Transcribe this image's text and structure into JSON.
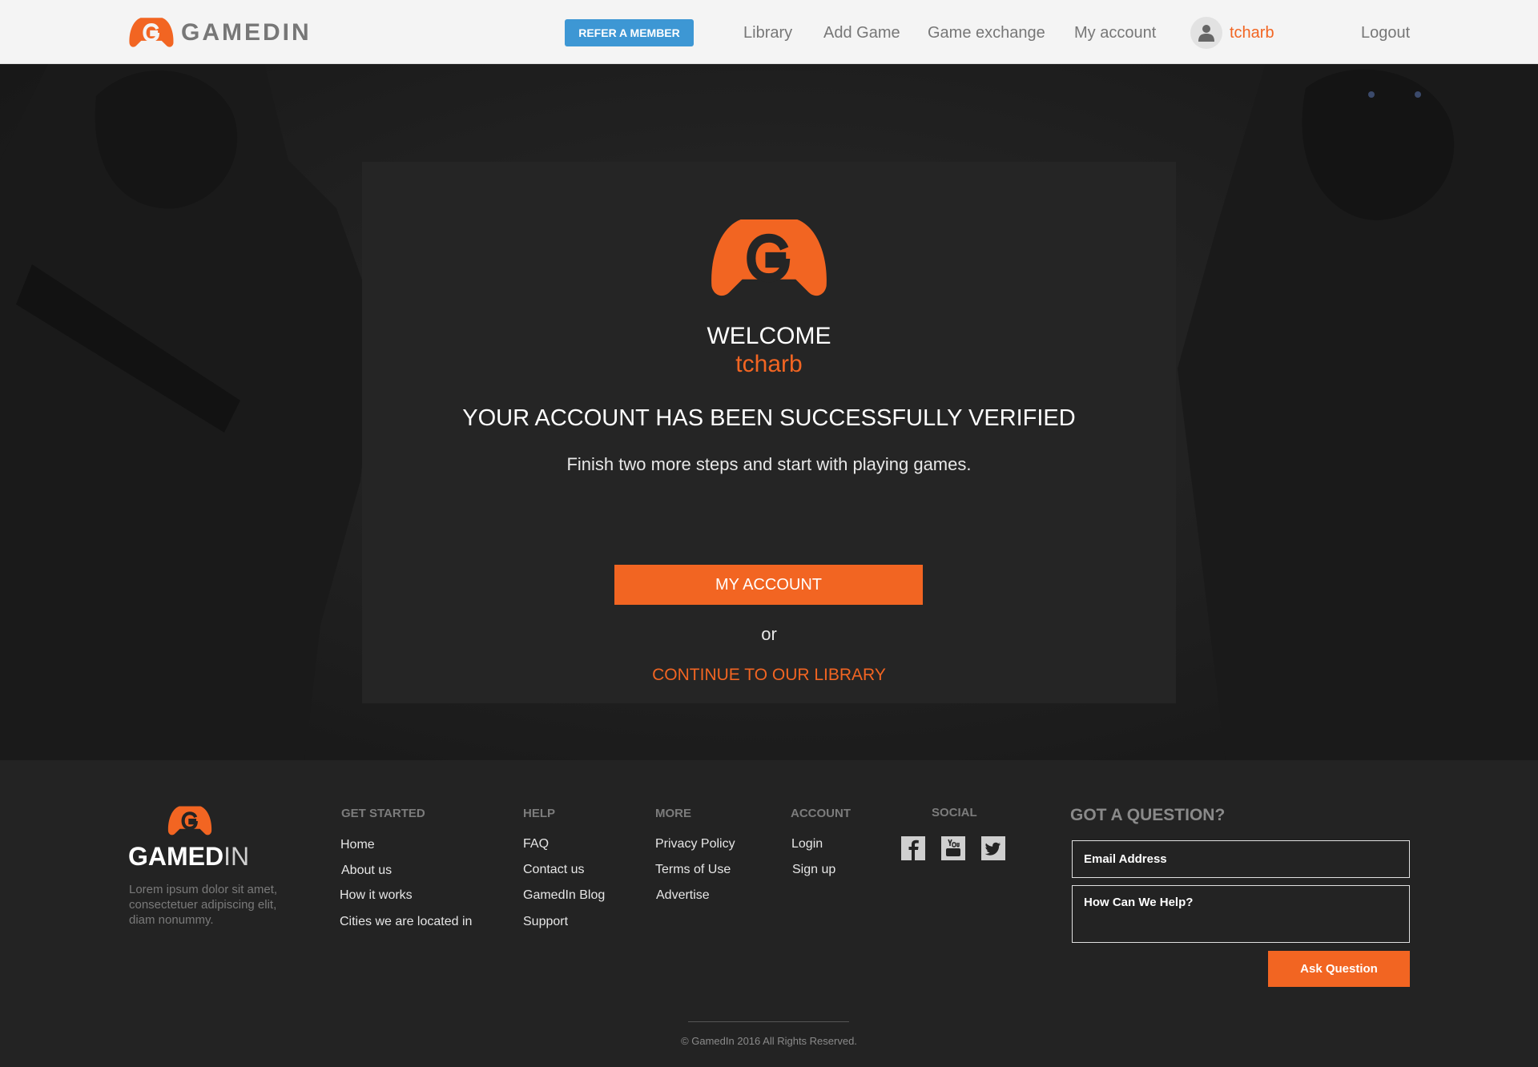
{
  "header": {
    "brand": "GAMEDIN",
    "refer_button": "REFER A MEMBER",
    "nav": [
      "Library",
      "Add Game",
      "Game exchange",
      "My account"
    ],
    "username": "tcharb",
    "logout": "Logout"
  },
  "card": {
    "welcome": "WELCOME",
    "username": "tcharb",
    "heading": "YOUR ACCOUNT HAS BEEN SUCCESSFULLY VERIFIED",
    "subtext": "Finish two more steps and start with playing games.",
    "primary_button": "MY ACCOUNT",
    "or": "or",
    "library_link": "CONTINUE TO OUR LIBRARY"
  },
  "footer": {
    "logo_main": "GAMED",
    "logo_in": "IN",
    "description": "Lorem ipsum dolor sit amet, consectetuer adipiscing elit, diam nonummy.",
    "columns": [
      {
        "heading": "GET STARTED",
        "links": [
          "Home",
          "About us",
          "How it works",
          "Cities we are located in"
        ]
      },
      {
        "heading": "HELP",
        "links": [
          "FAQ",
          "Contact us",
          "GamedIn Blog",
          "Support"
        ]
      },
      {
        "heading": "MORE",
        "links": [
          "Privacy Policy",
          "Terms of Use",
          "Advertise"
        ]
      },
      {
        "heading": "ACCOUNT",
        "links": [
          "Login",
          "Sign up"
        ]
      }
    ],
    "social": {
      "heading": "SOCIAL",
      "icons": [
        "facebook-icon",
        "youtube-icon",
        "twitter-icon"
      ]
    },
    "question": {
      "heading": "GOT A QUESTION?",
      "email_placeholder": "Email Address",
      "message_placeholder": "How Can We Help?",
      "button": "Ask Question"
    },
    "copyright": "© GamedIn 2016 All Rights Reserved."
  },
  "colors": {
    "accent": "#f26522",
    "refer_blue": "#3d97d4",
    "dark_bg": "#232323"
  }
}
